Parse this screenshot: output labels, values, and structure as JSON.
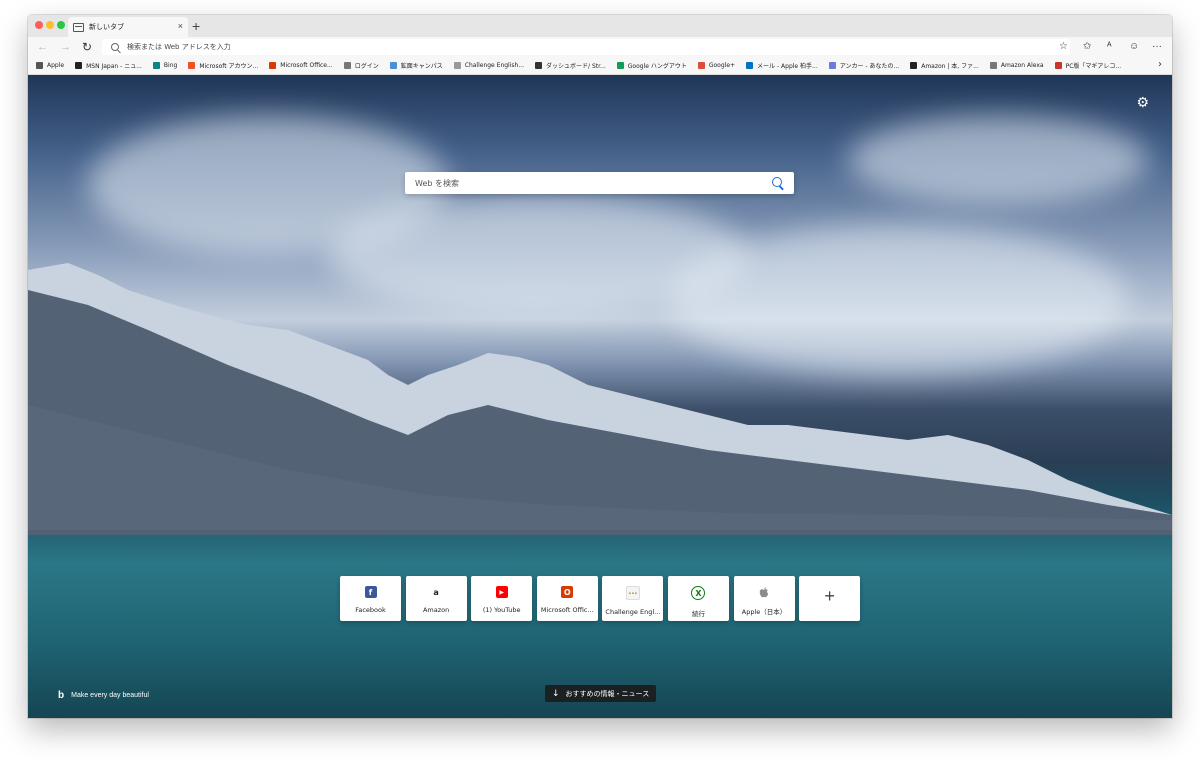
{
  "tab": {
    "title": "新しいタブ",
    "close": "×",
    "new_tab": "+"
  },
  "toolbar": {
    "back": "←",
    "forward": "→",
    "refresh": "↻",
    "address_placeholder": "検索または Web アドレスを入力",
    "favorite": "☆",
    "favorites_list": "✩",
    "profile": "ᴬ",
    "feedback": "☺",
    "more": "···"
  },
  "bookmarks": [
    {
      "label": "Apple",
      "color": "#555555"
    },
    {
      "label": "MSN Japan - ニュ...",
      "color": "#222222"
    },
    {
      "label": "Bing",
      "color": "#0c8484"
    },
    {
      "label": "Microsoft アカウン...",
      "color": "#f25022"
    },
    {
      "label": "Microsoft Office...",
      "color": "#d83b01"
    },
    {
      "label": "ログイン",
      "color": "#777777"
    },
    {
      "label": "鉱面キャンパス",
      "color": "#4a90d9"
    },
    {
      "label": "Challenge English...",
      "color": "#999999"
    },
    {
      "label": "ダッシュボード/ Str...",
      "color": "#333333"
    },
    {
      "label": "Google ハングアウト",
      "color": "#0f9d58"
    },
    {
      "label": "Google+",
      "color": "#dd4b39"
    },
    {
      "label": "メール - Apple 柏手...",
      "color": "#0072c6"
    },
    {
      "label": "アンカー - あなたの...",
      "color": "#6b7bd6"
    },
    {
      "label": "Amazon | 本, ファ...",
      "color": "#222222"
    },
    {
      "label": "Amazon Alexa",
      "color": "#777777"
    },
    {
      "label": "PC版「マギアレコ...",
      "color": "#c0392b"
    }
  ],
  "bookmarks_more": "›",
  "settings_icon": "⚙",
  "search": {
    "placeholder": "Web を検索"
  },
  "tiles": [
    {
      "label": "Facebook",
      "glyph": "f",
      "color": "#3b5998"
    },
    {
      "label": "Amazon",
      "glyph": "a",
      "color": "#222222"
    },
    {
      "label": "(1) YouTube",
      "glyph": "▶",
      "color": "#ff0000"
    },
    {
      "label": "Microsoft Offic...",
      "glyph": "O",
      "color": "#d83b01"
    },
    {
      "label": "Challenge Engl...",
      "glyph": "···",
      "color": "#b58900"
    },
    {
      "label": "続行",
      "glyph": "X",
      "color": "#107c10"
    },
    {
      "label": "Apple（日本）",
      "glyph": "",
      "color": "#888888"
    }
  ],
  "add_tile": "+",
  "bing_tagline": "Make every day beautiful",
  "bing_logo": "b",
  "news_button": "おすすめの情報・ニュース",
  "news_arrow": "↓"
}
